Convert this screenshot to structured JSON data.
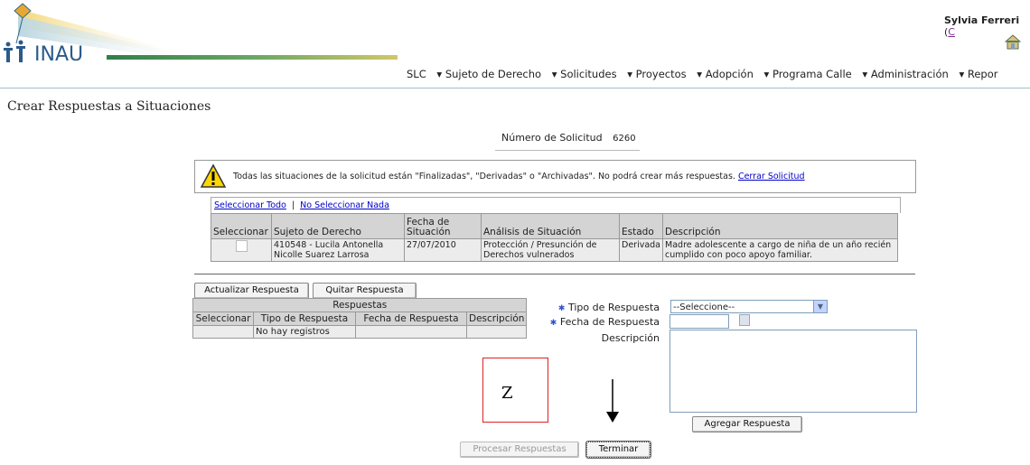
{
  "header": {
    "brand": "INAU",
    "user_name": "Sylvia Ferreri",
    "user_suffix": "(",
    "user_link": "C",
    "nav": [
      "SLC",
      "▾ Sujeto de Derecho",
      "▾ Solicitudes",
      "▾ Proyectos",
      "▾ Adopción",
      "▾ Programa Calle",
      "▾ Administración",
      "▾ Repor"
    ]
  },
  "page": {
    "title": "Crear Respuestas a Situaciones",
    "solicitud_label": "Número de Solicitud",
    "solicitud_number": "6260"
  },
  "warning": {
    "text": "Todas las situaciones de la solicitud están \"Finalizadas\", \"Derivadas\" o \"Archivadas\". No podrá crear más respuestas.",
    "link": "Cerrar Solicitud"
  },
  "selection": {
    "select_all": "Seleccionar Todo",
    "separator": "|",
    "select_none": "No Seleccionar Nada",
    "columns": [
      "Seleccionar",
      "Sujeto de Derecho",
      "Fecha de Situación",
      "Análisis de Situación",
      "Estado",
      "Descripción"
    ],
    "rows": [
      {
        "sujeto": "410548 - Lucila Antonella Nicolle Suarez Larrosa",
        "fecha": "27/07/2010",
        "analisis": "Protección / Presunción de Derechos vulnerados",
        "estado": "Derivada",
        "descripcion": "Madre adolescente a cargo de niña de un año recién cumplido con poco apoyo familiar."
      }
    ]
  },
  "respuestas": {
    "update_button": "Actualizar Respuesta",
    "remove_button": "Quitar Respuesta",
    "table_title": "Respuestas",
    "columns": [
      "Seleccionar",
      "Tipo de Respuesta",
      "Fecha de Respuesta",
      "Descripción"
    ],
    "empty": "No hay registros"
  },
  "form": {
    "tipo_label": "Tipo de Respuesta",
    "tipo_value": "--Seleccione--",
    "fecha_label": "Fecha de Respuesta",
    "descripcion_label": "Descripción",
    "add_button": "Agregar Respuesta"
  },
  "footer": {
    "process_button": "Procesar Respuestas",
    "finish_button": "Terminar"
  },
  "annotation": {
    "box_label": "Z",
    "box_color": "#e02020"
  }
}
